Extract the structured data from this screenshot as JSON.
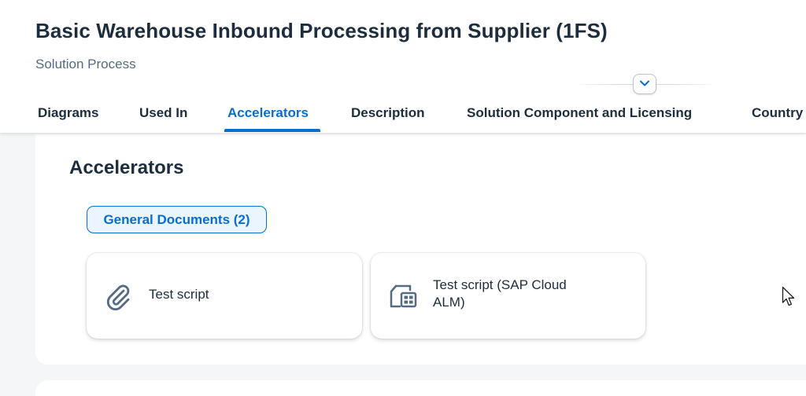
{
  "header": {
    "title": "Basic Warehouse Inbound Processing from Supplier (1FS)",
    "subtitle": "Solution Process"
  },
  "tabs": [
    {
      "label": "Diagrams",
      "active": false
    },
    {
      "label": "Used In",
      "active": false
    },
    {
      "label": "Accelerators",
      "active": true
    },
    {
      "label": "Description",
      "active": false
    },
    {
      "label": "Solution Component and Licensing",
      "active": false
    },
    {
      "label": "Country",
      "active": false
    }
  ],
  "accelerators": {
    "section_title": "Accelerators",
    "filter_chip": "General Documents (2)",
    "documents": [
      {
        "label": "Test script",
        "icon": "paperclip-icon"
      },
      {
        "label_line1": "Test script (SAP Cloud",
        "label_line2": "ALM)",
        "icon": "cloud-alm-icon"
      }
    ]
  },
  "colors": {
    "accent": "#0a6ed1",
    "text": "#1d2d3e",
    "muted": "#556b82",
    "icon": "#556b82",
    "background": "#f5f6f7"
  }
}
